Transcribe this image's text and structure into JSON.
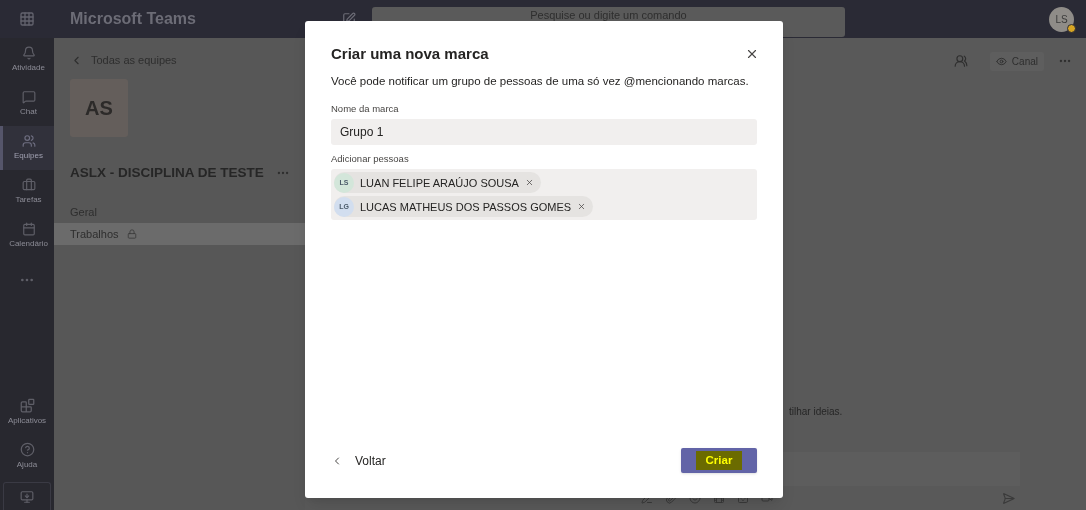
{
  "app": {
    "title": "Microsoft Teams"
  },
  "search": {
    "placeholder": "Pesquise ou digite um comando"
  },
  "user": {
    "initials": "LS"
  },
  "rail": {
    "items": [
      {
        "label": "Atividade",
        "selected": false
      },
      {
        "label": "Chat",
        "selected": false
      },
      {
        "label": "Equipes",
        "selected": true
      },
      {
        "label": "Tarefas",
        "selected": false
      },
      {
        "label": "Calendário",
        "selected": false
      }
    ],
    "bottom_items": [
      {
        "label": "Aplicativos"
      },
      {
        "label": "Ajuda"
      }
    ]
  },
  "team_panel": {
    "back_link": "Todas as equipes",
    "team_avatar": "AS",
    "team_name": "ASLX - DISCIPLINA DE TESTE",
    "channels": [
      {
        "name": "Geral",
        "selected": false,
        "private": false
      },
      {
        "name": "Trabalhos",
        "selected": true,
        "private": true
      }
    ]
  },
  "channel_header": {
    "view_button": "Canal"
  },
  "conversation": {
    "hint": "tilhar ideias."
  },
  "dialog": {
    "title": "Criar uma nova marca",
    "description": "Você pode notificar um grupo de pessoas de uma só vez @mencionando marcas.",
    "name_label": "Nome da marca",
    "name_value": "Grupo 1",
    "people_label": "Adicionar pessoas",
    "people": [
      {
        "initials": "LS",
        "name": "LUAN FELIPE ARAÚJO SOUSA",
        "color": "#d3e6da"
      },
      {
        "initials": "LG",
        "name": "LUCAS MATHEUS DOS PASSOS GOMES",
        "color": "#d2deef"
      }
    ],
    "back_button": "Voltar",
    "create_button": {
      "label": "Criar",
      "highlighted": true
    }
  }
}
